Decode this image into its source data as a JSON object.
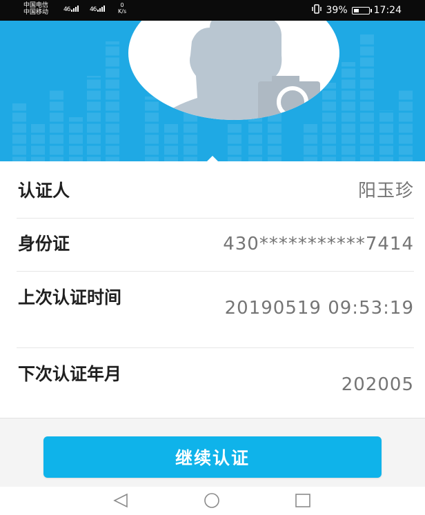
{
  "status_bar": {
    "carrier_1": "中国电信",
    "carrier_2": "中国移动",
    "signal_1": "46",
    "signal_2": "46",
    "net_speed_value": "0",
    "net_speed_unit": "K/s",
    "battery_percent": "39%",
    "battery_level": 0.39,
    "time": "17:24"
  },
  "profile": {
    "avatar_icon": "person-silhouette-icon",
    "camera_icon": "camera-icon"
  },
  "info": {
    "rows": [
      {
        "label": "认证人",
        "value": "阳玉珍"
      },
      {
        "label": "身份证",
        "value": "430***********7414"
      },
      {
        "label": "上次认证时间",
        "value": "20190519 09:53:19"
      },
      {
        "label": "下次认证年月",
        "value": "202005"
      }
    ]
  },
  "actions": {
    "continue_label": "继续认证"
  },
  "nav": {
    "back_icon": "back-triangle-icon",
    "home_icon": "home-circle-icon",
    "recents_icon": "recents-square-icon"
  },
  "colors": {
    "header_blue": "#1fa9e4",
    "button_blue": "#0fb3ea"
  }
}
